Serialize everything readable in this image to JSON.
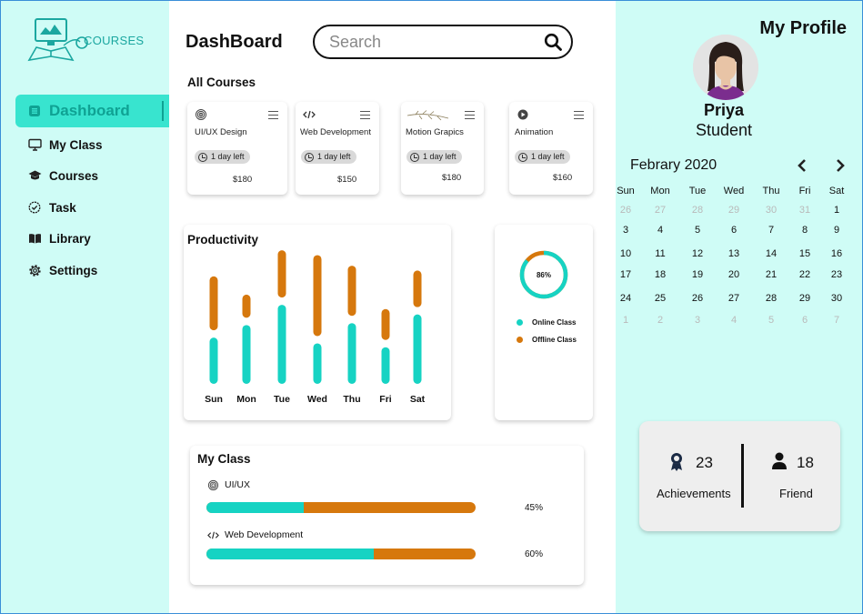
{
  "sidebar": {
    "logo_text": "COURSES",
    "items": [
      {
        "label": "Dashboard",
        "icon": "list-icon"
      },
      {
        "label": "My Class",
        "icon": "monitor-icon"
      },
      {
        "label": "Courses",
        "icon": "graduation-cap-icon"
      },
      {
        "label": "Task",
        "icon": "check-circle-icon"
      },
      {
        "label": "Library",
        "icon": "book-icon"
      },
      {
        "label": "Settings",
        "icon": "gear-icon"
      }
    ],
    "active_index": 0
  },
  "header": {
    "title": "DashBoard",
    "search_placeholder": "Search"
  },
  "all_courses": {
    "title": "All Courses",
    "courses": [
      {
        "name": "UI/UX Design",
        "time": "1 day left",
        "price": "$180",
        "icon": "fingerprint-icon"
      },
      {
        "name": "Web Development",
        "time": "1 day left",
        "price": "$150",
        "icon": "code-icon"
      },
      {
        "name": "Motion Grapics",
        "time": "1 day left",
        "price": "$180",
        "icon": "branch-icon"
      },
      {
        "name": "Animation",
        "time": "1 day left",
        "price": "$160",
        "icon": "play-icon"
      }
    ]
  },
  "productivity": {
    "title": "Productivity"
  },
  "class_split": {
    "percent_label": "86%",
    "percent": 86,
    "legend": [
      {
        "label": "Online Class",
        "color": "#16d3c3"
      },
      {
        "label": "Offline Class",
        "color": "#d6780d"
      }
    ]
  },
  "chart_data": {
    "type": "bar",
    "title": "Productivity",
    "categories": [
      "Sun",
      "Mon",
      "Tue",
      "Wed",
      "Thu",
      "Fri",
      "Sat"
    ],
    "series": [
      {
        "name": "Online Class",
        "color": "#16d3c3",
        "values": [
          48,
          61,
          82,
          42,
          63,
          38,
          72
        ]
      },
      {
        "name": "Offline Class",
        "color": "#d6780d",
        "values": [
          56,
          24,
          49,
          84,
          52,
          32,
          38
        ]
      }
    ],
    "stacked": true,
    "ylim": [
      0,
      140
    ],
    "grid": false
  },
  "my_class": {
    "title": "My Class",
    "items": [
      {
        "label": "UI/UX",
        "icon": "fingerprint-icon",
        "progress": 0.36,
        "percent_label": "45%"
      },
      {
        "label": "Web Development",
        "icon": "code-icon",
        "progress": 0.62,
        "percent_label": "60%"
      }
    ]
  },
  "profile": {
    "title": "My Profile",
    "name": "Priya",
    "role": "Student",
    "achievements_count": "23",
    "achievements_label": "Achievements",
    "friends_count": "18",
    "friends_label": "Friend"
  },
  "calendar": {
    "month": "Febrary 2020",
    "weekdays": [
      "Sun",
      "Mon",
      "Tue",
      "Wed",
      "Thu",
      "Fri",
      "Sat"
    ],
    "weeks": [
      [
        "26",
        "27",
        "28",
        "29",
        "30",
        "31",
        "1"
      ],
      [
        "3",
        "4",
        "5",
        "6",
        "7",
        "8",
        "9"
      ],
      [
        "10",
        "11",
        "12",
        "13",
        "14",
        "15",
        "16"
      ],
      [
        "17",
        "18",
        "19",
        "20",
        "21",
        "22",
        "23"
      ],
      [
        "24",
        "25",
        "26",
        "27",
        "28",
        "29",
        "30"
      ],
      [
        "1",
        "2",
        "3",
        "4",
        "5",
        "6",
        "7"
      ]
    ],
    "muted": [
      [
        true,
        true,
        true,
        true,
        true,
        true,
        false
      ],
      [
        false,
        false,
        false,
        false,
        false,
        false,
        false
      ],
      [
        false,
        false,
        false,
        false,
        false,
        false,
        false
      ],
      [
        false,
        false,
        false,
        false,
        false,
        false,
        false
      ],
      [
        false,
        false,
        false,
        false,
        false,
        false,
        false
      ],
      [
        true,
        true,
        true,
        true,
        true,
        true,
        true
      ]
    ]
  },
  "colors": {
    "accent": "#16d3c3",
    "secondary": "#d6780d",
    "panel_bg": "#cffcf6"
  }
}
